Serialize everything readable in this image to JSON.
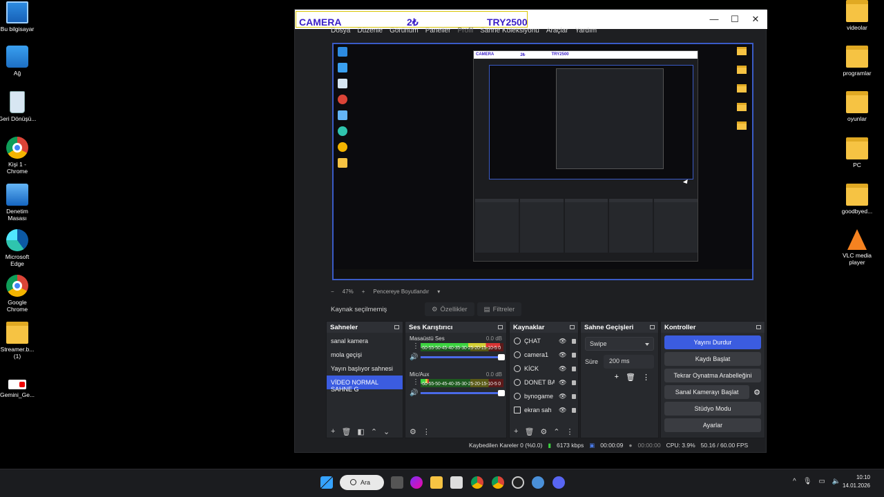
{
  "desktop": {
    "left_icons": [
      {
        "label": "Bu bilgisayar",
        "icon": "pc"
      },
      {
        "label": "Ağ",
        "icon": "net"
      },
      {
        "label": "Geri Dönüşü...",
        "icon": "bin"
      },
      {
        "label": "Kişi 1 - Chrome",
        "icon": "chrome"
      },
      {
        "label": "Denetim Masası",
        "icon": "cp"
      },
      {
        "label": "Microsoft Edge",
        "icon": "edge"
      },
      {
        "label": "Google Chrome",
        "icon": "chrome"
      },
      {
        "label": "Streamer.b... (1)",
        "icon": "folder"
      },
      {
        "label": "Gemini_Ge...",
        "icon": "yt"
      }
    ],
    "right_icons": [
      {
        "label": "videolar",
        "icon": "folder"
      },
      {
        "label": "programlar",
        "icon": "folder"
      },
      {
        "label": "oyunlar",
        "icon": "folder"
      },
      {
        "label": "PC",
        "icon": "folder"
      },
      {
        "label": "goodbyed...",
        "icon": "folder"
      },
      {
        "label": "VLC media player",
        "icon": "vlc"
      }
    ]
  },
  "window": {
    "title_camera": "CAMERA",
    "title_coin": "2₺",
    "title_try": "TRY2500",
    "menu": [
      "Dosya",
      "Düzenle",
      "Görünüm",
      "Paneller",
      "Profil",
      "Sahne Koleksiyonu",
      "Araçlar",
      "Yardım"
    ]
  },
  "preview": {
    "nested_title": [
      "CAMERA",
      "2₺",
      "TRY2500"
    ]
  },
  "zoom": {
    "minus": "−",
    "value": "47%",
    "plus": "+",
    "fit_label": "Pencereye Boyutlandır"
  },
  "source_bar": {
    "label": "Kaynak seçilmemiş",
    "properties": "Özellikler",
    "filters": "Filtreler"
  },
  "docks": {
    "scenes": {
      "title": "Sahneler",
      "items": [
        "sanal kamera",
        "mola geçişi",
        "Yayın başlıyor sahnesi",
        "VİDEO NORMAL SAHNE G"
      ]
    },
    "mixer": {
      "title": "Ses Karıştırıcı",
      "channels": [
        {
          "name": "Masaüstü Ses",
          "db": "0.0 dB",
          "level": 0.96
        },
        {
          "name": "Mic/Aux",
          "db": "0.0 dB",
          "level": 0.1
        }
      ],
      "scale": "-60-55-50-45-40-35-30-25-20-15-10-5 0"
    },
    "sources": {
      "title": "Kaynaklar",
      "items": [
        "ÇHAT",
        "camera1",
        "KİCK",
        "DONET BA",
        "bynogame",
        "ekran sah"
      ]
    },
    "transitions": {
      "title": "Sahne Geçişleri",
      "type": "Swipe",
      "duration_label": "Süre",
      "duration": "200 ms"
    },
    "controls": {
      "title": "Kontroller",
      "buttons": [
        "Yayını Durdur",
        "Kaydı Başlat",
        "Tekrar Oynatma Arabelleğini Başlat",
        "Sanal Kamerayı Başlat",
        "Stüdyo Modu",
        "Ayarlar"
      ]
    }
  },
  "status": {
    "dropped": "Kaybedilen Kareler 0 (%0.0)",
    "bitrate": "6173 kbps",
    "stream_time": "00:00:09",
    "rec_time": "00:00:00",
    "cpu": "CPU: 3.9%",
    "fps": "50.16 / 60.00 FPS"
  },
  "taskbar": {
    "search": "Ara",
    "time": "10:10",
    "date": "14.01.2026"
  },
  "colors": {
    "accent": "#3b5ce0",
    "title_text": "#3a1fc7",
    "bg": "#1e1f22"
  }
}
